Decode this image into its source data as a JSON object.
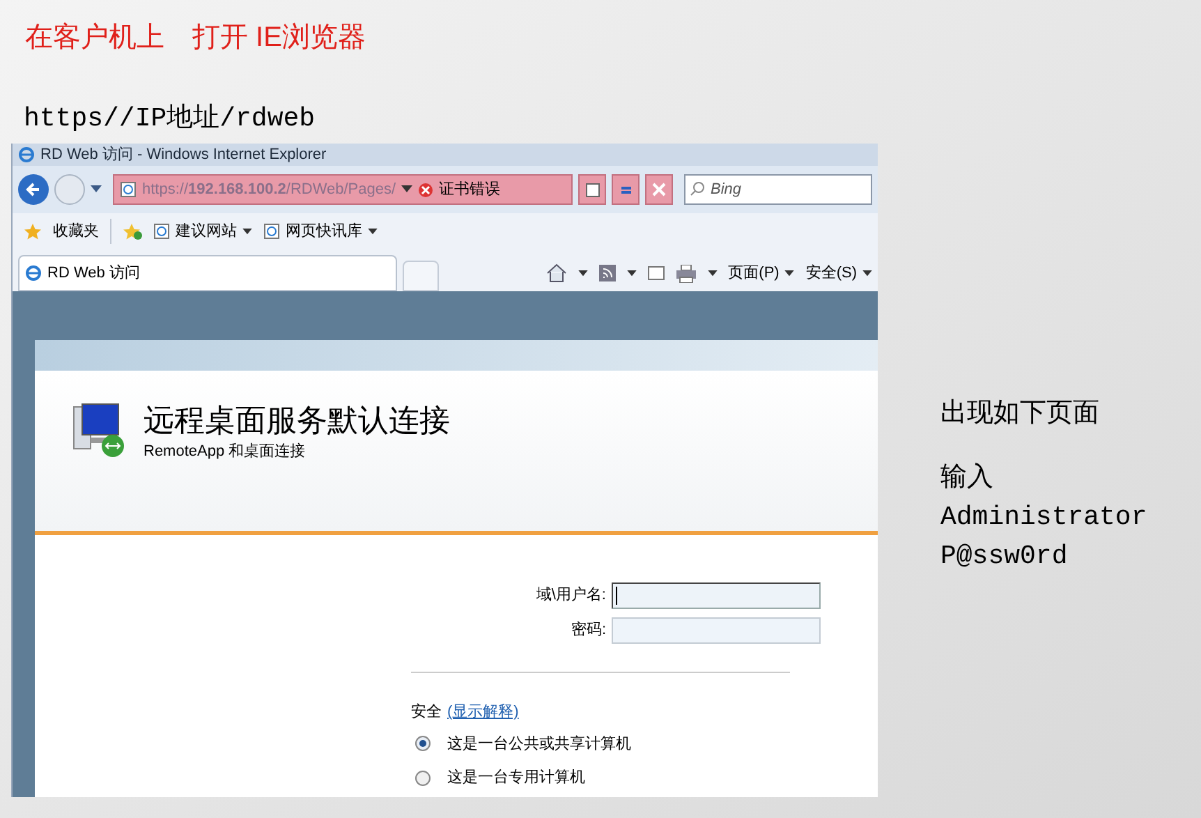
{
  "slide": {
    "title": "在客户机上　打开 IE浏览器",
    "url_hint": "https//IP地址/rdweb",
    "notes": [
      "出现如下页面",
      "输入",
      "Administrator",
      "P@ssw0rd"
    ]
  },
  "browser": {
    "title": "RD Web 访问 - Windows Internet Explorer",
    "address": "https://**192.168.100.2**/RDWeb/Pages/",
    "cert_error": "证书错误",
    "search": {
      "placeholder": "Bing"
    },
    "favorites": {
      "label": "收藏夹",
      "links": [
        "建议网站",
        "网页快讯库"
      ]
    },
    "tab": {
      "label": "RD Web 访问"
    },
    "commands": [
      "页面(P)",
      "安全(S)"
    ]
  },
  "page": {
    "heading": "远程桌面服务默认连接",
    "subtitle": "RemoteApp 和桌面连接",
    "fields": [
      {
        "label": "域\\用户名:",
        "focused": true
      },
      {
        "label": "密码:",
        "focused": false
      }
    ],
    "security": {
      "label": "安全",
      "link": "(显示解释)"
    },
    "options": [
      {
        "label": "这是一台公共或共享计算机",
        "selected": true
      },
      {
        "label": "这是一台专用计算机",
        "selected": false
      }
    ]
  }
}
